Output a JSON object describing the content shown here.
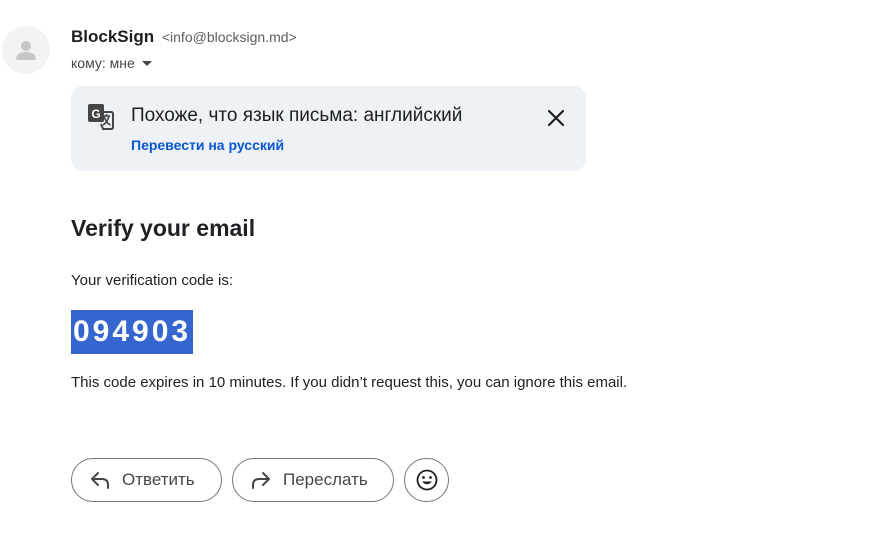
{
  "sender": {
    "name": "BlockSign",
    "email": "<info@blocksign.md>",
    "recipient_label": "кому: мне"
  },
  "translate_banner": {
    "title": "Похоже, что язык письма: английский",
    "link": "Перевести на русский"
  },
  "email_body": {
    "heading": "Verify your email",
    "intro": "Your verification code is:",
    "code": "094903",
    "expiry_note": "This code expires in 10 minutes. If you didn’t request this, you can ignore this email."
  },
  "actions": {
    "reply_label": "Ответить",
    "forward_label": "Переслать"
  },
  "icons": {
    "avatar": "person-icon",
    "translate": "translate-icon",
    "close": "close-icon",
    "reply": "reply-icon",
    "forward": "forward-icon",
    "emoji": "emoji-icon",
    "recipient_toggle": "caret-down-icon"
  },
  "colors": {
    "link": "#0b57d0",
    "banner_bg": "#eef1f6",
    "code_highlight": "#3566cf"
  }
}
